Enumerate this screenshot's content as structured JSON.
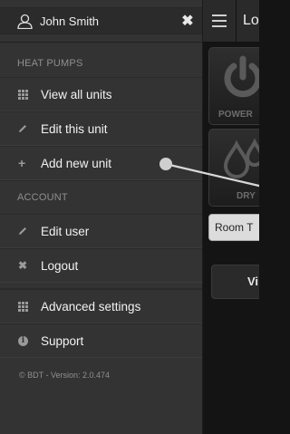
{
  "menu": {
    "user_name": "John Smith",
    "sections": {
      "heat_pumps": "HEAT PUMPS",
      "account": "ACCOUNT"
    },
    "heat_pump_items": [
      {
        "label": "View all units",
        "icon": "grid-icon"
      },
      {
        "label": "Edit this unit",
        "icon": "pencil-icon"
      },
      {
        "label": "Add new unit",
        "icon": "plus-icon"
      }
    ],
    "account_items": [
      {
        "label": "Edit user",
        "icon": "pencil-icon"
      },
      {
        "label": "Logout",
        "icon": "close-icon"
      }
    ],
    "other_items": [
      {
        "label": "Advanced settings",
        "icon": "grid-icon"
      },
      {
        "label": "Support",
        "icon": "info-icon"
      }
    ],
    "footer": "© BDT - Version: 2.0.474"
  },
  "main": {
    "title": "Lo",
    "tiles": [
      {
        "label": "POWER",
        "icon": "power-icon"
      },
      {
        "label": "DRY",
        "icon": "drop-icon"
      }
    ],
    "room_button": "Room T",
    "view_button": "Vi"
  }
}
